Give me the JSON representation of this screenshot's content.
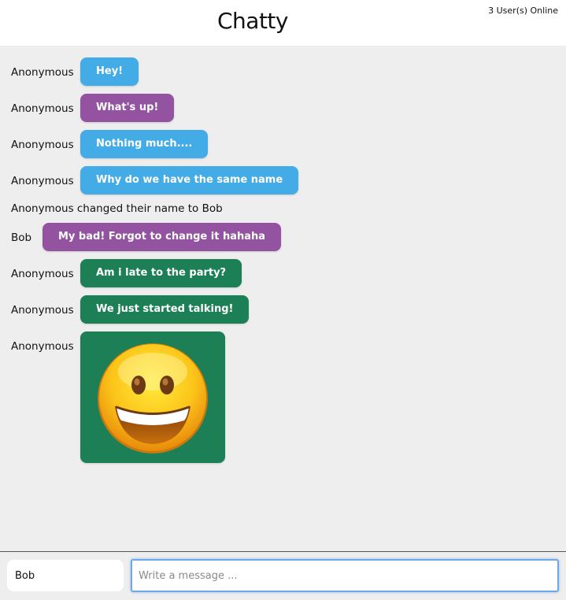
{
  "header": {
    "title": "Chatty",
    "online_count": "3 User(s) Online"
  },
  "colors": {
    "blue": "#43abe6",
    "purple": "#9453a0",
    "green": "#1c7f55"
  },
  "messages": [
    {
      "type": "message",
      "user": "Anonymous",
      "text": "Hey!",
      "color": "#43abe6"
    },
    {
      "type": "message",
      "user": "Anonymous",
      "text": "What's up!",
      "color": "#9453a0"
    },
    {
      "type": "message",
      "user": "Anonymous",
      "text": "Nothing much....",
      "color": "#43abe6"
    },
    {
      "type": "message",
      "user": "Anonymous",
      "text": "Why do we have the same name",
      "color": "#43abe6"
    },
    {
      "type": "notification",
      "text": "Anonymous changed their name to Bob"
    },
    {
      "type": "message",
      "user": "Bob",
      "text": "My bad! Forgot to change it hahaha",
      "color": "#9453a0"
    },
    {
      "type": "message",
      "user": "Anonymous",
      "text": "Am i late to the party?",
      "color": "#1c7f55"
    },
    {
      "type": "message",
      "user": "Anonymous",
      "text": "We just started talking!",
      "color": "#1c7f55"
    },
    {
      "type": "image",
      "user": "Anonymous",
      "icon": "grinning-face-emoji",
      "color": "#1c7f55"
    }
  ],
  "footer": {
    "name_value": "Bob",
    "message_placeholder": "Write a message ..."
  }
}
